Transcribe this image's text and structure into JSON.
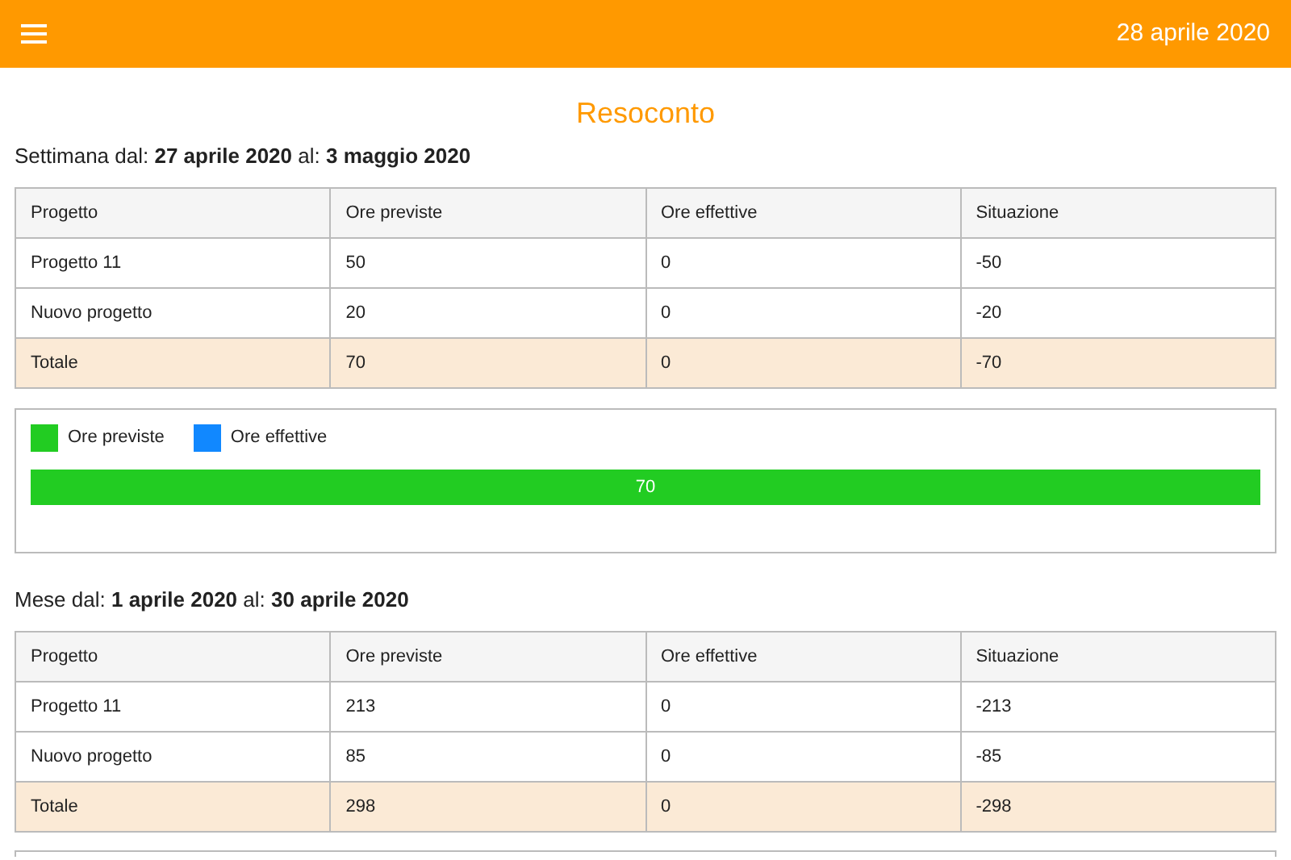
{
  "header": {
    "date": "28 aprile 2020"
  },
  "title": "Resoconto",
  "sections": [
    {
      "heading": "Settimana dal: **27 aprile 2020** al: **3 maggio 2020**",
      "table": {
        "columns": [
          "Progetto",
          "Ore previste",
          "Ore effettive",
          "Situazione"
        ],
        "rows": [
          {
            "kind": "item",
            "cells": [
              "Progetto 11",
              "50",
              "0",
              "-50"
            ]
          },
          {
            "kind": "item",
            "cells": [
              "Nuovo progetto",
              "20",
              "0",
              "-20"
            ]
          },
          {
            "kind": "total",
            "cells": [
              "Totale",
              "70",
              "0",
              "-70"
            ]
          }
        ]
      },
      "chart": {
        "legend": [
          {
            "name": "Ore previste",
            "color": "#22cc22"
          },
          {
            "name": "Ore effettive",
            "color": "#1188ff"
          }
        ],
        "bar": {
          "label": "70"
        }
      }
    },
    {
      "heading": "Mese dal: **1 aprile 2020** al: **30 aprile 2020**",
      "table": {
        "columns": [
          "Progetto",
          "Ore previste",
          "Ore effettive",
          "Situazione"
        ],
        "rows": [
          {
            "kind": "item",
            "cells": [
              "Progetto 11",
              "213",
              "0",
              "-213"
            ]
          },
          {
            "kind": "item",
            "cells": [
              "Nuovo progetto",
              "85",
              "0",
              "-85"
            ]
          },
          {
            "kind": "total",
            "cells": [
              "Totale",
              "298",
              "0",
              "-298"
            ]
          }
        ]
      }
    }
  ]
}
